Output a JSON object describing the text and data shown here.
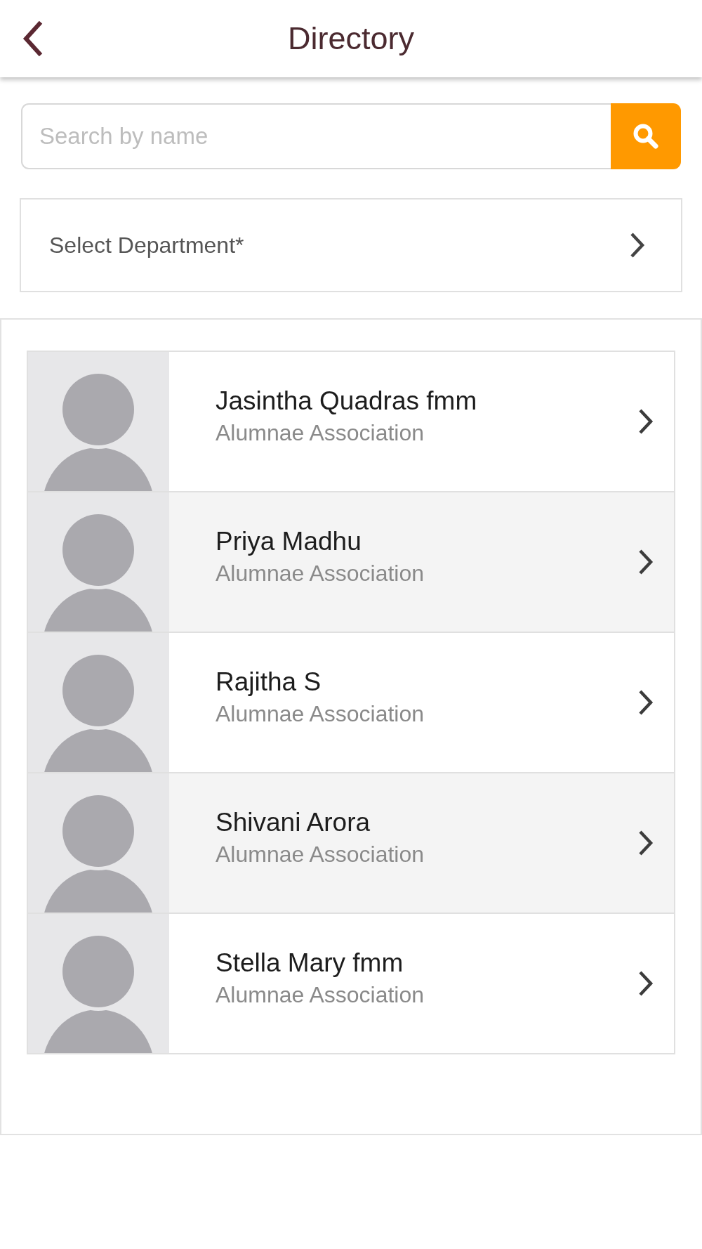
{
  "header": {
    "title": "Directory"
  },
  "search": {
    "placeholder": "Search by name"
  },
  "department_select": {
    "label": "Select Department*"
  },
  "people": [
    {
      "name": "Jasintha Quadras fmm",
      "department": "Alumnae Association"
    },
    {
      "name": "Priya Madhu",
      "department": "Alumnae Association"
    },
    {
      "name": "Rajitha S",
      "department": "Alumnae Association"
    },
    {
      "name": "Shivani Arora",
      "department": "Alumnae Association"
    },
    {
      "name": "Stella Mary fmm",
      "department": "Alumnae Association"
    }
  ]
}
